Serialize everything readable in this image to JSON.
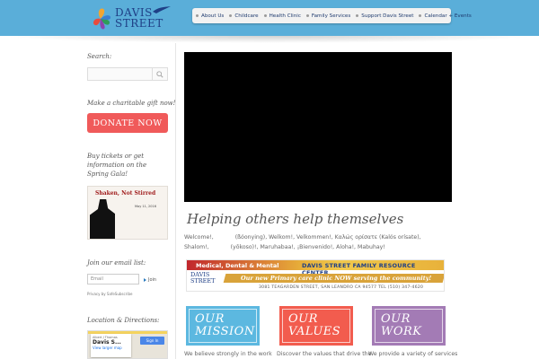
{
  "header": {
    "logo_line1": "DAVIS",
    "logo_line2": "STREET",
    "nav": [
      {
        "label": "About Us"
      },
      {
        "label": "Childcare"
      },
      {
        "label": "Health Clinic"
      },
      {
        "label": "Family Services"
      },
      {
        "label": "Support Davis Street"
      },
      {
        "label": "Calendar + Events"
      }
    ]
  },
  "sidebar": {
    "search_label": "Search:",
    "donate_prompt": "Make a charitable gift now!",
    "donate_button": "DONATE NOW",
    "gala_text": "Buy tickets or get information on the Spring Gala!",
    "gala_image": {
      "title": "Shaken, Not Stirred",
      "date": "May 11, 2016"
    },
    "email_label": "Join our email list:",
    "email_placeholder": "Email",
    "join_label": "Join",
    "privacy_text": "Privacy by SafeSubscribe",
    "location_label": "Location & Directions:",
    "map": {
      "card_title": "Davis S...",
      "card_link": "View larger map",
      "sign_in": "Sign In",
      "place_label": "Albert J Thomas"
    }
  },
  "main": {
    "title": "Helping others help themselves",
    "welcome_line1_a": "Welcome!,",
    "welcome_line1_b": "(ßóonying), Welkom!, Velkommen!, Καλώς ορίσατε (Kalós orísate),",
    "welcome_line2_a": "Shalom!,",
    "welcome_line2_b": "(yōkoso)!, Maruhabaa!, ¡Bienvenido!, Aloha!, Mabuhay!",
    "banner": {
      "top_left": "Medical, Dental & Mental",
      "top_right": "DAVIS STREET FAMILY RESOURCE CENTER",
      "logo_line1": "DAVIS",
      "logo_line2": "STREET",
      "stripe": "Our new Primary care clinic NOW serving the community!",
      "address": "3081 TEAGARDEN STREET, SAN LEANDRO CA 94577 TEL (510) 347-4620"
    },
    "cards": [
      {
        "line1": "OUR",
        "line2": "MISSION",
        "desc": "We believe strongly in the work"
      },
      {
        "line1": "OUR",
        "line2": "VALUES",
        "desc": "Discover the values that drive the"
      },
      {
        "line1": "OUR",
        "line2": "WORK",
        "desc": "We provide a variety of services"
      }
    ]
  },
  "colors": {
    "header": "#5aaed9",
    "donate": "#f05a5a",
    "mission": "#5cb8e0",
    "values": "#f25c4e",
    "work": "#a37bb5"
  }
}
